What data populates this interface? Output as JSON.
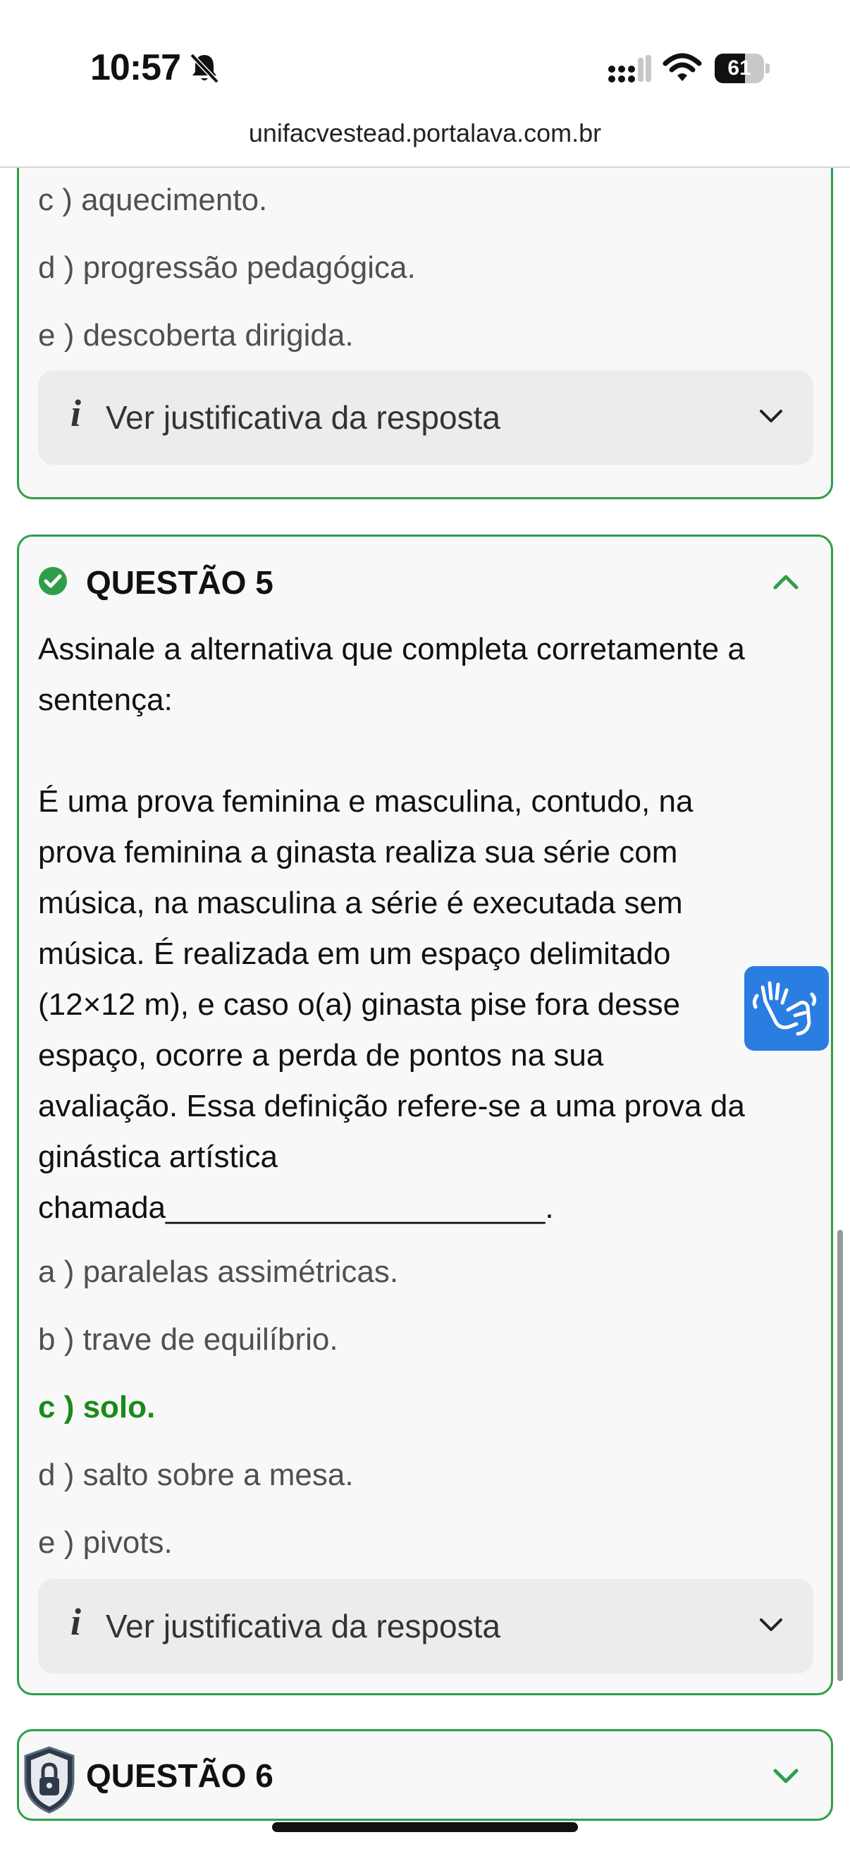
{
  "status_bar": {
    "time": "10:57",
    "battery_percent": "61",
    "battery_level": 0.61
  },
  "browser": {
    "url": "unifacvestead.portalava.com.br"
  },
  "question4": {
    "options": [
      {
        "letter": "c",
        "text": "c ) aquecimento."
      },
      {
        "letter": "d",
        "text": "d ) progressão pedagógica."
      },
      {
        "letter": "e",
        "text": "e ) descoberta dirigida."
      }
    ],
    "justification_label": "Ver justificativa da resposta"
  },
  "question5": {
    "title": "QUESTÃO 5",
    "status": "correct",
    "prompt_lines": [
      "Assinale a alternativa que completa corretamente a",
      "sentença:"
    ],
    "body_lines": [
      "É uma prova feminina e masculina, contudo, na",
      "prova feminina a ginasta realiza sua série com",
      "música, na masculina a série é executada sem",
      "música. É realizada em um espaço delimitado",
      "(12×12 m), e caso o(a) ginasta pise fora desse",
      "espaço, ocorre a perda de pontos na sua",
      "avaliação. Essa definição refere-se a uma prova da",
      "ginástica artística",
      "chamada______________________."
    ],
    "options": [
      {
        "letter": "a",
        "text": "a ) paralelas assimétricas.",
        "correct": false
      },
      {
        "letter": "b",
        "text": "b ) trave de equilíbrio.",
        "correct": false
      },
      {
        "letter": "c",
        "text": "c ) solo.",
        "correct": true
      },
      {
        "letter": "d",
        "text": "d ) salto sobre a mesa.",
        "correct": false
      },
      {
        "letter": "e",
        "text": "e ) pivots.",
        "correct": false
      }
    ],
    "justification_label": "Ver justificativa da resposta"
  },
  "question6": {
    "title": "QUESTÃO 6"
  },
  "colors": {
    "accent_green": "#2e9e4a",
    "correct_text": "#1a8a1a",
    "libras_blue": "#2a7de1"
  },
  "icons": [
    "bell-slash-icon",
    "cellular-signal-icon",
    "wifi-icon",
    "battery-icon",
    "info-icon",
    "chevron-down-icon",
    "chevron-up-icon",
    "check-circle-icon",
    "sign-language-icon",
    "lock-shield-icon"
  ]
}
